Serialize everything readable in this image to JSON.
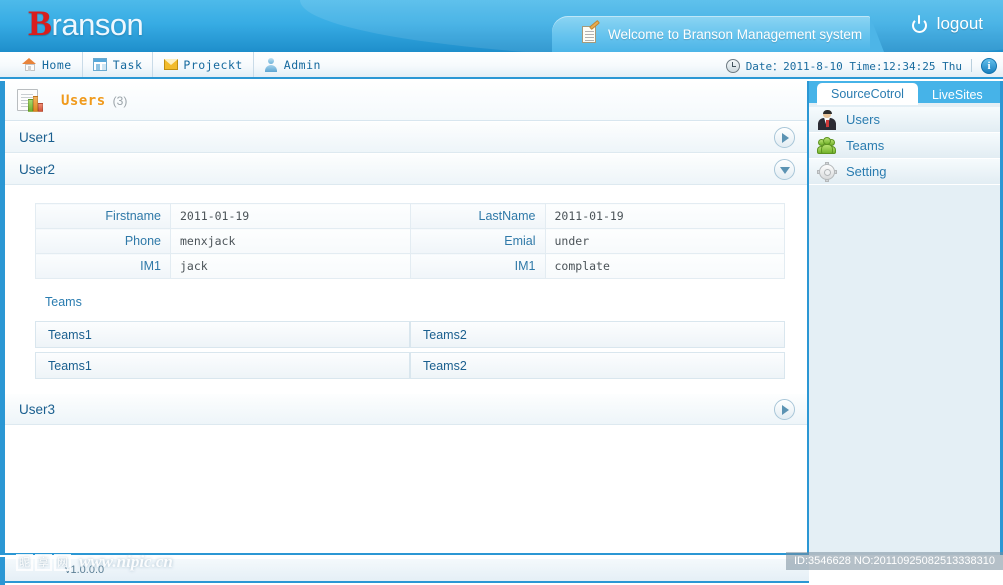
{
  "header": {
    "logo_first": "B",
    "logo_rest": "ranson",
    "welcome": "Welcome to Branson Management system",
    "logout_label": "logout",
    "logout_icon": "power-icon",
    "welcome_icon": "notepad-icon"
  },
  "nav": {
    "items": [
      {
        "label": "Home",
        "icon": "home-icon"
      },
      {
        "label": "Task",
        "icon": "window-icon"
      },
      {
        "label": "Projeckt",
        "icon": "mail-icon"
      },
      {
        "label": "Admin",
        "icon": "user-icon"
      }
    ],
    "datetime": "Date：2011-8-10 Time:12:34:25 Thu",
    "clock_icon": "clock-icon",
    "info_icon": "info-icon"
  },
  "panel": {
    "icon": "report-chart-icon",
    "title": "Users",
    "count": "(3)"
  },
  "users": [
    {
      "name": "User1",
      "state": "collapsed",
      "toggle_icon": "triangle-right-icon"
    },
    {
      "name": "User2",
      "state": "expanded",
      "toggle_icon": "triangle-down-icon"
    },
    {
      "name": "User3",
      "state": "collapsed",
      "toggle_icon": "triangle-right-icon"
    }
  ],
  "detail": {
    "rows": [
      {
        "label_left": "Firstname",
        "value_left": "2011-01-19",
        "label_right": "LastName",
        "value_right": "2011-01-19"
      },
      {
        "label_left": "Phone",
        "value_left": "menxjack",
        "label_right": "Emial",
        "value_right": "under"
      },
      {
        "label_left": "IM1",
        "value_left": "jack",
        "label_right": "IM1",
        "value_right": "complate"
      }
    ],
    "teams_heading": "Teams",
    "teams_rows": [
      {
        "c1": "Teams1",
        "c2": "Teams2"
      },
      {
        "c1": "Teams1",
        "c2": "Teams2"
      }
    ]
  },
  "sidebar": {
    "tabs": [
      {
        "label": "SourceCotrol",
        "active": true
      },
      {
        "label": "LiveSites",
        "active": false
      }
    ],
    "items": [
      {
        "label": "Users",
        "icon": "person-suit-icon"
      },
      {
        "label": "Teams",
        "icon": "people-group-icon"
      },
      {
        "label": "Setting",
        "icon": "gear-icon"
      }
    ]
  },
  "footer": {
    "version": "v1.0.0.0",
    "watermark_url": "www.nipic.cn",
    "watermark_badge": [
      "昵",
      "享",
      "网"
    ],
    "id_text": "ID:3546628 NO:20110925082513338310"
  },
  "colors": {
    "accent_blue": "#2b97d4",
    "header_blue": "#37ace4",
    "title_orange": "#f09a1c",
    "link_blue": "#1a5f8f",
    "logo_red": "#d81e1e"
  }
}
